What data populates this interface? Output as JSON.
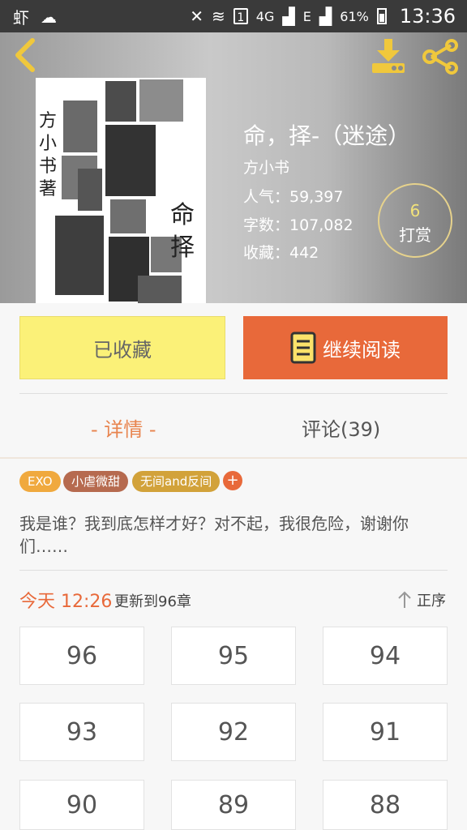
{
  "status_bar": {
    "carrier_icon": "虾",
    "sim_slot": "1",
    "net_4g": "4G",
    "net_e": "E",
    "battery": "61%",
    "time": "13:36"
  },
  "book": {
    "title": "命，择-（迷途）",
    "author": "方小书",
    "popularity": "人气：59,397",
    "word_count": "字数：107,082",
    "favorites": "收藏：442",
    "cover_author_vertical": "方小书 著",
    "cover_title_art": "命择"
  },
  "tip": {
    "count": "6",
    "label": "打赏"
  },
  "buttons": {
    "favorited": "已收藏",
    "continue_reading": "继续阅读"
  },
  "tabs": {
    "detail": "- 详情 -",
    "comments": "评论(39)"
  },
  "tags": [
    {
      "label": "EXO",
      "color": "#f0a93e"
    },
    {
      "label": "小虐微甜",
      "color": "#b66a4f"
    },
    {
      "label": "无间and反间",
      "color": "#d2a23a"
    }
  ],
  "tag_add": "+",
  "description": "我是谁？我到底怎样才好？对不起，我很危险，谢谢你们……",
  "update": {
    "time": "今天 12:26",
    "text": "更新到96章",
    "sort_label": "正序"
  },
  "chapters": [
    "96",
    "95",
    "94",
    "93",
    "92",
    "91",
    "90",
    "89",
    "88"
  ],
  "icons": {
    "back": "back-arrow-icon",
    "download": "download-icon",
    "share": "share-icon",
    "book": "book-icon",
    "sort": "sort-arrow-icon"
  },
  "colors": {
    "accent": "#e8693a",
    "fav_button": "#fbf178",
    "tip_count": "#f2e27a"
  }
}
